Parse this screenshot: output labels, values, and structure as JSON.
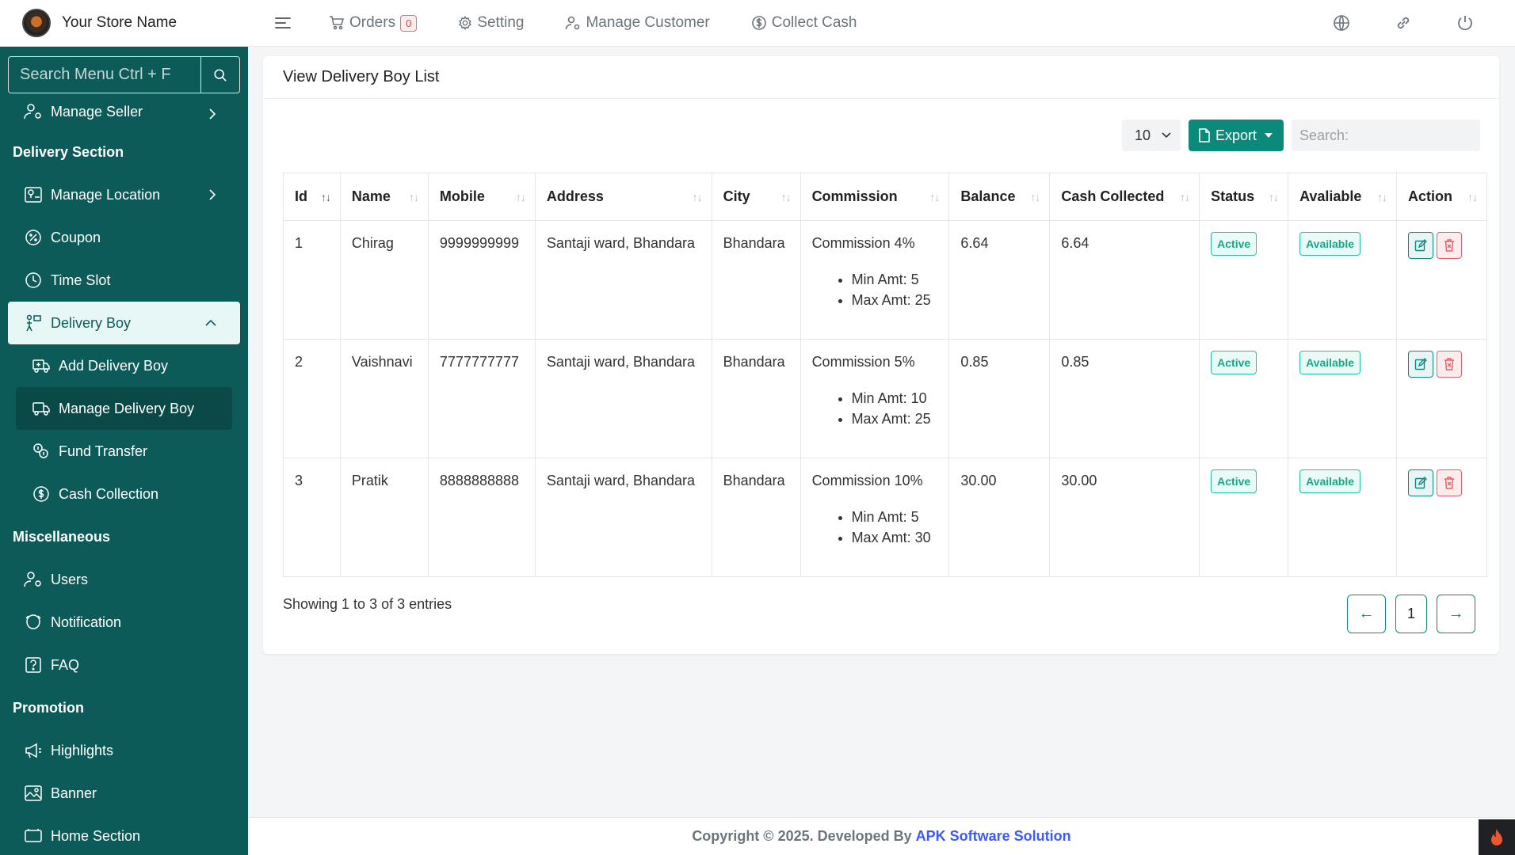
{
  "brand": {
    "name": "Your Store Name"
  },
  "topnav": {
    "orders_label": "Orders",
    "orders_count": "0",
    "setting_label": "Setting",
    "manage_customer_label": "Manage Customer",
    "collect_cash_label": "Collect Cash"
  },
  "sidebar": {
    "search_placeholder": "Search Menu Ctrl + F",
    "manage_seller": "Manage Seller",
    "delivery_section": "Delivery Section",
    "manage_location": "Manage Location",
    "coupon": "Coupon",
    "time_slot": "Time Slot",
    "delivery_boy": "Delivery Boy",
    "add_delivery_boy": "Add Delivery Boy",
    "manage_delivery_boy": "Manage Delivery Boy",
    "fund_transfer": "Fund Transfer",
    "cash_collection": "Cash Collection",
    "miscellaneous": "Miscellaneous",
    "users": "Users",
    "notification": "Notification",
    "faq": "FAQ",
    "promotion": "Promotion",
    "highlights": "Highlights",
    "banner": "Banner",
    "home_section": "Home Section"
  },
  "main": {
    "title": "View Delivery Boy List",
    "page_size": "10",
    "export_label": "Export",
    "search_placeholder": "Search:",
    "columns": [
      "Id",
      "Name",
      "Mobile",
      "Address",
      "City",
      "Commission",
      "Balance",
      "Cash Collected",
      "Status",
      "Avaliable",
      "Action"
    ],
    "rows": [
      {
        "id": "1",
        "name": "Chirag",
        "mobile": "9999999999",
        "address": "Santaji ward, Bhandara",
        "city": "Bhandara",
        "commission": "Commission 4%",
        "min": "Min Amt: 5",
        "max": "Max Amt: 25",
        "balance": "6.64",
        "cash_collected": "6.64",
        "status": "Active",
        "available": "Available"
      },
      {
        "id": "2",
        "name": "Vaishnavi",
        "mobile": "7777777777",
        "address": "Santaji ward, Bhandara",
        "city": "Bhandara",
        "commission": "Commission 5%",
        "min": "Min Amt: 10",
        "max": "Max Amt: 25",
        "balance": "0.85",
        "cash_collected": "0.85",
        "status": "Active",
        "available": "Available"
      },
      {
        "id": "3",
        "name": "Pratik",
        "mobile": "8888888888",
        "address": "Santaji ward, Bhandara",
        "city": "Bhandara",
        "commission": "Commission 10%",
        "min": "Min Amt: 5",
        "max": "Max Amt: 30",
        "balance": "30.00",
        "cash_collected": "30.00",
        "status": "Active",
        "available": "Available"
      }
    ],
    "showing": "Showing 1 to 3 of 3 entries",
    "current_page": "1",
    "prev_arrow": "←",
    "next_arrow": "→"
  },
  "footer": {
    "copyright": "Copyright © 2025. Developed By",
    "company": "APK Software Solution"
  },
  "colors": {
    "sidebar_bg": "#0c5b59",
    "accent": "#0b8a7c",
    "status_green": "#18a886",
    "danger": "#e35d6a",
    "link_blue": "#3d5afe"
  }
}
